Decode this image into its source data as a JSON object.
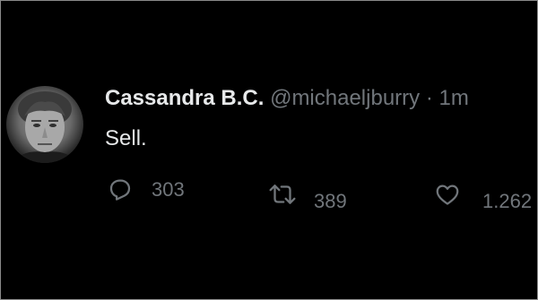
{
  "tweet": {
    "display_name": "Cassandra B.C.",
    "handle": "@michaeljburry",
    "separator": "·",
    "time": "1m",
    "text": "Sell."
  },
  "actions": {
    "reply_count": "303",
    "retweet_count": "389",
    "like_count": "1.262"
  },
  "icons": {
    "reply": "reply-icon",
    "retweet": "retweet-icon",
    "like": "heart-icon"
  },
  "colors": {
    "background": "#000000",
    "primary_text": "#e7e9ea",
    "secondary_text": "#71767b"
  }
}
